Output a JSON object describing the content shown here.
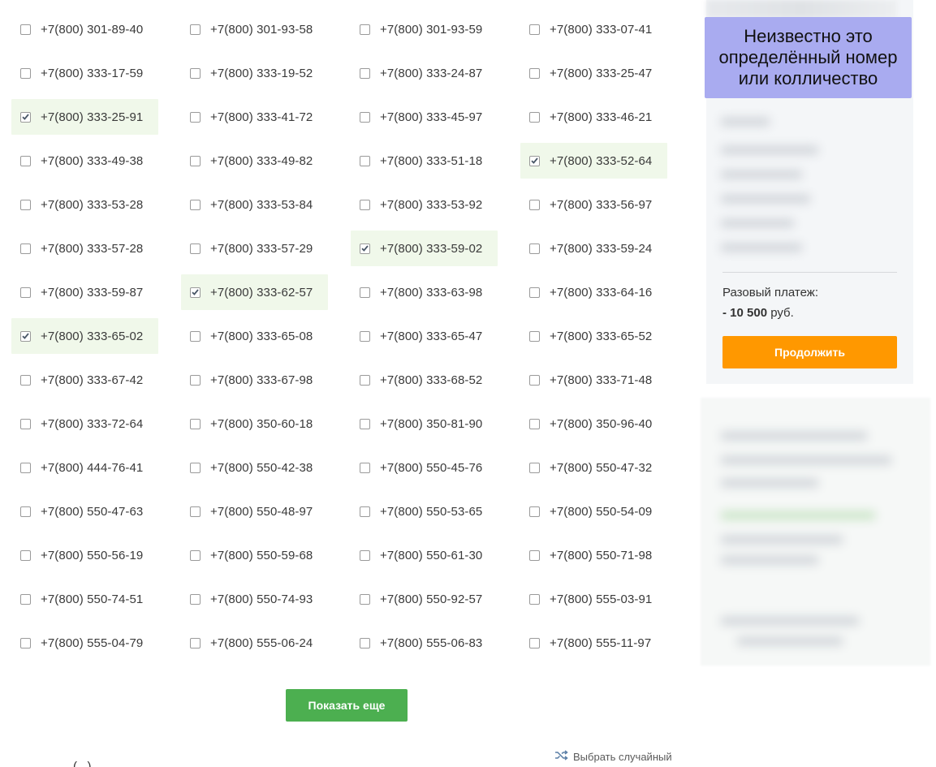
{
  "numbers": [
    {
      "label": "+7(800) 301-89-40",
      "checked": false
    },
    {
      "label": "+7(800) 301-93-58",
      "checked": false
    },
    {
      "label": "+7(800) 301-93-59",
      "checked": false
    },
    {
      "label": "+7(800) 333-07-41",
      "checked": false
    },
    {
      "label": "+7(800) 333-17-59",
      "checked": false
    },
    {
      "label": "+7(800) 333-19-52",
      "checked": false
    },
    {
      "label": "+7(800) 333-24-87",
      "checked": false
    },
    {
      "label": "+7(800) 333-25-47",
      "checked": false
    },
    {
      "label": "+7(800) 333-25-91",
      "checked": true
    },
    {
      "label": "+7(800) 333-41-72",
      "checked": false
    },
    {
      "label": "+7(800) 333-45-97",
      "checked": false
    },
    {
      "label": "+7(800) 333-46-21",
      "checked": false
    },
    {
      "label": "+7(800) 333-49-38",
      "checked": false
    },
    {
      "label": "+7(800) 333-49-82",
      "checked": false
    },
    {
      "label": "+7(800) 333-51-18",
      "checked": false
    },
    {
      "label": "+7(800) 333-52-64",
      "checked": true
    },
    {
      "label": "+7(800) 333-53-28",
      "checked": false
    },
    {
      "label": "+7(800) 333-53-84",
      "checked": false
    },
    {
      "label": "+7(800) 333-53-92",
      "checked": false
    },
    {
      "label": "+7(800) 333-56-97",
      "checked": false
    },
    {
      "label": "+7(800) 333-57-28",
      "checked": false
    },
    {
      "label": "+7(800) 333-57-29",
      "checked": false
    },
    {
      "label": "+7(800) 333-59-02",
      "checked": true
    },
    {
      "label": "+7(800) 333-59-24",
      "checked": false
    },
    {
      "label": "+7(800) 333-59-87",
      "checked": false
    },
    {
      "label": "+7(800) 333-62-57",
      "checked": true
    },
    {
      "label": "+7(800) 333-63-98",
      "checked": false
    },
    {
      "label": "+7(800) 333-64-16",
      "checked": false
    },
    {
      "label": "+7(800) 333-65-02",
      "checked": true
    },
    {
      "label": "+7(800) 333-65-08",
      "checked": false
    },
    {
      "label": "+7(800) 333-65-47",
      "checked": false
    },
    {
      "label": "+7(800) 333-65-52",
      "checked": false
    },
    {
      "label": "+7(800) 333-67-42",
      "checked": false
    },
    {
      "label": "+7(800) 333-67-98",
      "checked": false
    },
    {
      "label": "+7(800) 333-68-52",
      "checked": false
    },
    {
      "label": "+7(800) 333-71-48",
      "checked": false
    },
    {
      "label": "+7(800) 333-72-64",
      "checked": false
    },
    {
      "label": "+7(800) 350-60-18",
      "checked": false
    },
    {
      "label": "+7(800) 350-81-90",
      "checked": false
    },
    {
      "label": "+7(800) 350-96-40",
      "checked": false
    },
    {
      "label": "+7(800) 444-76-41",
      "checked": false
    },
    {
      "label": "+7(800) 550-42-38",
      "checked": false
    },
    {
      "label": "+7(800) 550-45-76",
      "checked": false
    },
    {
      "label": "+7(800) 550-47-32",
      "checked": false
    },
    {
      "label": "+7(800) 550-47-63",
      "checked": false
    },
    {
      "label": "+7(800) 550-48-97",
      "checked": false
    },
    {
      "label": "+7(800) 550-53-65",
      "checked": false
    },
    {
      "label": "+7(800) 550-54-09",
      "checked": false
    },
    {
      "label": "+7(800) 550-56-19",
      "checked": false
    },
    {
      "label": "+7(800) 550-59-68",
      "checked": false
    },
    {
      "label": "+7(800) 550-61-30",
      "checked": false
    },
    {
      "label": "+7(800) 550-71-98",
      "checked": false
    },
    {
      "label": "+7(800) 550-74-51",
      "checked": false
    },
    {
      "label": "+7(800) 550-74-93",
      "checked": false
    },
    {
      "label": "+7(800) 550-92-57",
      "checked": false
    },
    {
      "label": "+7(800) 555-03-91",
      "checked": false
    },
    {
      "label": "+7(800) 555-04-79",
      "checked": false
    },
    {
      "label": "+7(800) 555-06-24",
      "checked": false
    },
    {
      "label": "+7(800) 555-06-83",
      "checked": false
    },
    {
      "label": "+7(800) 555-11-97",
      "checked": false
    }
  ],
  "show_more_label": "Показать еще",
  "random_label": "Выбрать случайный",
  "cutoff_text": "(...)",
  "annotation": "Неизвестно это определённый номер или колличество",
  "payment": {
    "label": "Разовый платеж:",
    "amount": "- 10 500",
    "currency": "руб.",
    "continue_label": "Продолжить"
  },
  "colors": {
    "checked_bg": "#f0f8ea",
    "show_more": "#4caf50",
    "continue": "#ff9800",
    "annotation_bg": "#a9abf0"
  },
  "icons": {
    "checkbox": "checkbox-icon",
    "checkmark": "checkmark-icon",
    "shuffle": "shuffle-icon"
  }
}
